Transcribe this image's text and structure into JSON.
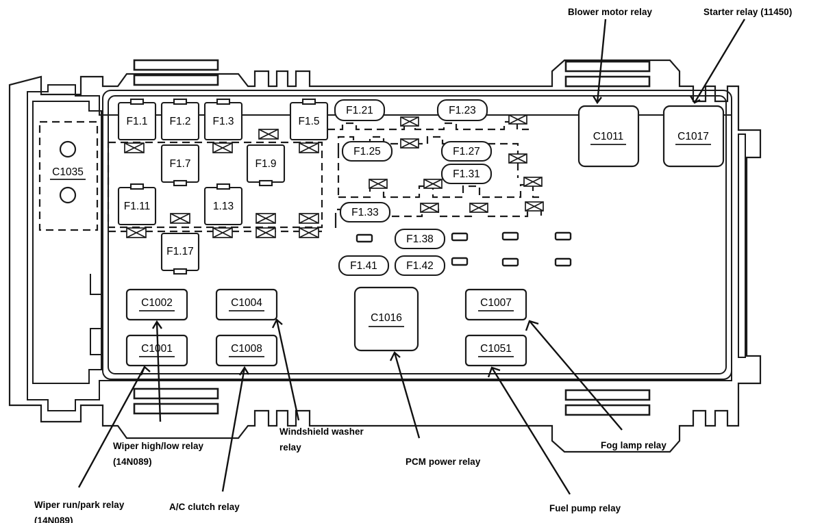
{
  "diagram": {
    "title": "Power distribution box / fuse box layout",
    "line_color": "#1a1a1a",
    "background": "#ffffff"
  },
  "fuses": [
    {
      "id": "f1_1",
      "label": "F1.1",
      "shape": "square"
    },
    {
      "id": "f1_2",
      "label": "F1.2",
      "shape": "square"
    },
    {
      "id": "f1_3",
      "label": "F1.3",
      "shape": "square"
    },
    {
      "id": "f1_5",
      "label": "F1.5",
      "shape": "square"
    },
    {
      "id": "f1_7",
      "label": "F1.7",
      "shape": "square"
    },
    {
      "id": "f1_9",
      "label": "F1.9",
      "shape": "square"
    },
    {
      "id": "f1_11",
      "label": "F1.11",
      "shape": "square"
    },
    {
      "id": "f1_13",
      "label": "1.13",
      "shape": "square"
    },
    {
      "id": "f1_17",
      "label": "F1.17",
      "shape": "square"
    },
    {
      "id": "f1_21",
      "label": "F1.21",
      "shape": "pill"
    },
    {
      "id": "f1_23",
      "label": "F1.23",
      "shape": "pill"
    },
    {
      "id": "f1_25",
      "label": "F1.25",
      "shape": "pill"
    },
    {
      "id": "f1_27",
      "label": "F1.27",
      "shape": "pill"
    },
    {
      "id": "f1_31",
      "label": "F1.31",
      "shape": "pill"
    },
    {
      "id": "f1_33",
      "label": "F1.33",
      "shape": "pill"
    },
    {
      "id": "f1_38",
      "label": "F1.38",
      "shape": "pill"
    },
    {
      "id": "f1_41",
      "label": "F1.41",
      "shape": "pill"
    },
    {
      "id": "f1_42",
      "label": "F1.42",
      "shape": "pill"
    }
  ],
  "connectors": [
    {
      "id": "c1035",
      "label": "C1035",
      "underlined": true
    },
    {
      "id": "c1011",
      "label": "C1011",
      "underlined": true
    },
    {
      "id": "c1017",
      "label": "C1017",
      "underlined": true
    },
    {
      "id": "c1002",
      "label": "C1002",
      "underlined": true
    },
    {
      "id": "c1001",
      "label": "C1001",
      "underlined": true
    },
    {
      "id": "c1004",
      "label": "C1004",
      "underlined": true
    },
    {
      "id": "c1008",
      "label": "C1008",
      "underlined": true
    },
    {
      "id": "c1016",
      "label": "C1016",
      "underlined": true
    },
    {
      "id": "c1007",
      "label": "C1007",
      "underlined": true
    },
    {
      "id": "c1051",
      "label": "C1051",
      "underlined": true
    }
  ],
  "callouts": {
    "blower_motor_relay": "Blower motor relay",
    "starter_relay": "Starter relay (11450)",
    "wiper_high_low_relay": "Wiper high/low relay\n(14N089)",
    "wiper_run_park_relay": "Wiper run/park relay\n(14N089)",
    "ac_clutch_relay": "A/C clutch relay",
    "windshield_washer_relay": "Windshield washer\nrelay",
    "pcm_power_relay": "PCM power relay",
    "fog_lamp_relay": "Fog lamp relay",
    "fuel_pump_relay": "Fuel pump relay"
  }
}
